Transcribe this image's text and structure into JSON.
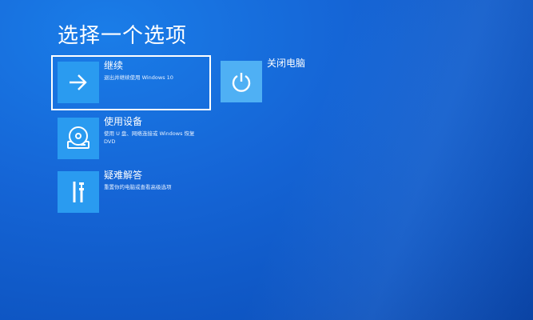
{
  "page": {
    "title": "选择一个选项"
  },
  "options": [
    {
      "label": "继续",
      "description": "退出并继续使用 Windows 10",
      "icon": "arrow-right-icon",
      "selected": true
    },
    {
      "label": "使用设备",
      "description": "使用 U 盘、网络连接或 Windows 恢复 DVD",
      "icon": "disc-drive-icon",
      "selected": false
    },
    {
      "label": "疑难解答",
      "description": "重置你的电脑或查看高级选项",
      "icon": "tools-icon",
      "selected": false
    },
    {
      "label": "关闭电脑",
      "description": "",
      "icon": "power-icon",
      "selected": false
    }
  ],
  "colors": {
    "background": "#1565d6",
    "tile": "#2a9bf0",
    "tile_light": "#4fb0f4",
    "text": "#ffffff"
  }
}
